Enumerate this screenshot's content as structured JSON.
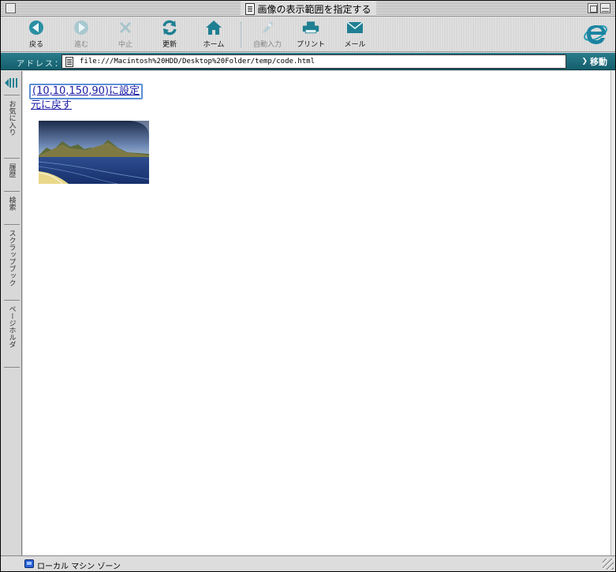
{
  "window": {
    "title": "画像の表示範囲を指定する"
  },
  "toolbar": {
    "back_label": "戻る",
    "forward_label": "進む",
    "stop_label": "中止",
    "refresh_label": "更新",
    "home_label": "ホーム",
    "autofill_label": "自動入力",
    "print_label": "プリント",
    "mail_label": "メール",
    "accent_color": "#1e7d8e"
  },
  "address_bar": {
    "label": "アドレス：",
    "url": "file:///Macintosh%20HDD/Desktop%20Folder/temp/code.html",
    "go_label": "移動"
  },
  "sidebar": {
    "tabs": [
      "お気に入り",
      "履歴",
      "検索",
      "スクラップブック",
      "ページホルダ"
    ]
  },
  "content": {
    "links": {
      "set_clip": "(10,10,150,90)に設定",
      "reset_clip": "元に戻す"
    },
    "image_name": "landscape-image",
    "link_color": "#1a1aa6"
  },
  "status_bar": {
    "zone_text": "ローカル マシン ゾーン"
  }
}
